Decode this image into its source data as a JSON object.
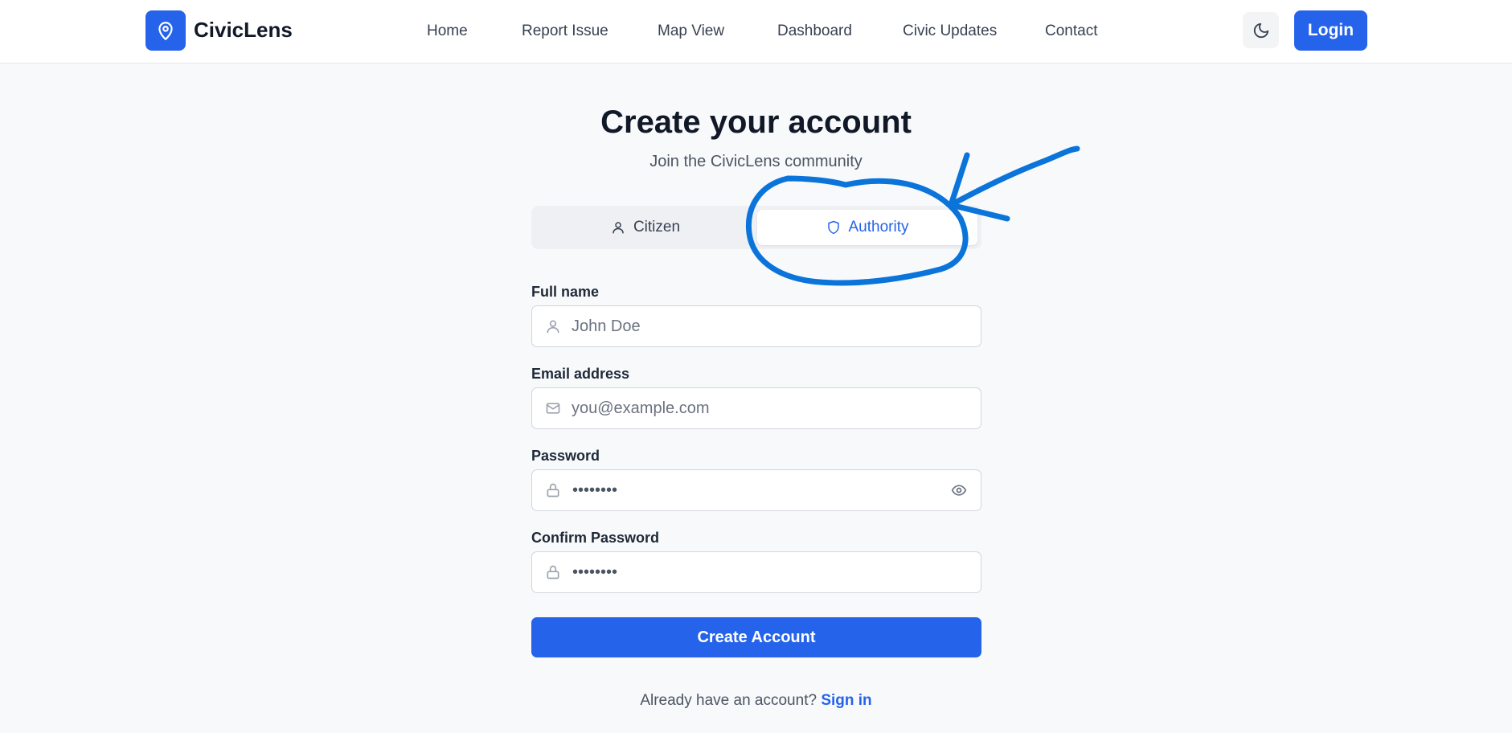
{
  "brand": {
    "name": "CivicLens",
    "logo_icon": "map-pin-icon",
    "accent": "#2563eb"
  },
  "nav": {
    "items": [
      {
        "label": "Home"
      },
      {
        "label": "Report Issue"
      },
      {
        "label": "Map View"
      },
      {
        "label": "Dashboard"
      },
      {
        "label": "Civic Updates"
      },
      {
        "label": "Contact"
      }
    ],
    "theme_icon": "moon-icon",
    "login_label": "Login"
  },
  "page": {
    "title": "Create your account",
    "subtitle": "Join the CivicLens community"
  },
  "role_toggle": {
    "options": [
      {
        "label": "Citizen",
        "icon": "user-icon",
        "selected": false
      },
      {
        "label": "Authority",
        "icon": "shield-icon",
        "selected": true
      }
    ]
  },
  "form": {
    "full_name": {
      "label": "Full name",
      "placeholder": "John Doe",
      "icon": "user-icon"
    },
    "email": {
      "label": "Email address",
      "placeholder": "you@example.com",
      "icon": "mail-icon"
    },
    "password": {
      "label": "Password",
      "value": "••••••••",
      "icon": "lock-icon",
      "toggle_icon": "eye-icon"
    },
    "confirm_password": {
      "label": "Confirm Password",
      "value": "••••••••",
      "icon": "lock-icon"
    },
    "submit_label": "Create Account"
  },
  "footer": {
    "prompt": "Already have an account?",
    "link": "Sign in"
  },
  "annotation": {
    "color": "#0a74da",
    "description_icon": "hand-drawn-circle-arrow"
  }
}
